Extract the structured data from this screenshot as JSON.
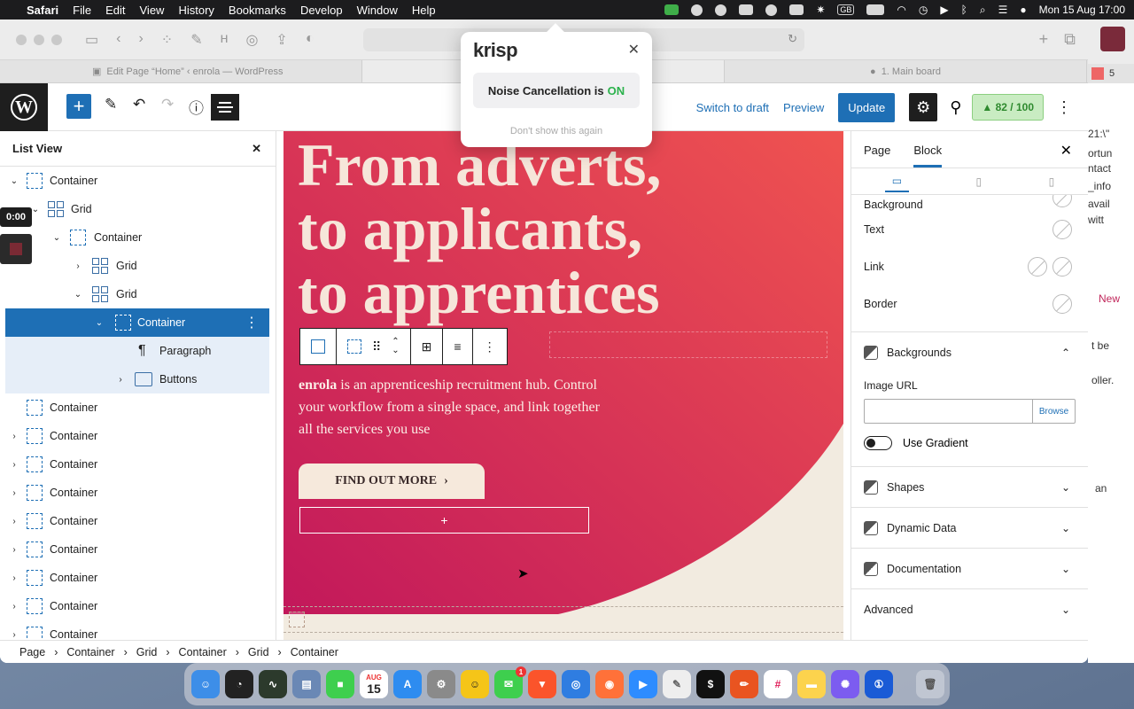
{
  "menubar": {
    "apple": "",
    "app": "Safari",
    "menus": [
      "File",
      "Edit",
      "View",
      "History",
      "Bookmarks",
      "Develop",
      "Window",
      "Help"
    ],
    "datetime": "Mon 15 Aug  17:00",
    "keyboard": "GB"
  },
  "browser": {
    "tabs": [
      {
        "label": "Edit Page “Home” ‹ enrola — WordPress"
      },
      {
        "label": ""
      },
      {
        "label": "1. Main board"
      }
    ]
  },
  "wp_toolbar": {
    "switch_draft": "Switch to draft",
    "preview": "Preview",
    "update": "Update",
    "score": "82 / 100"
  },
  "list_view": {
    "title": "List View",
    "items": [
      {
        "label": "Container",
        "type": "container"
      },
      {
        "label": "Grid",
        "type": "grid"
      },
      {
        "label": "Container",
        "type": "container"
      },
      {
        "label": "Grid",
        "type": "grid"
      },
      {
        "label": "Grid",
        "type": "grid"
      },
      {
        "label": "Container",
        "type": "container"
      },
      {
        "label": "Paragraph",
        "type": "paragraph"
      },
      {
        "label": "Buttons",
        "type": "buttons"
      },
      {
        "label": "Container",
        "type": "container"
      },
      {
        "label": "Container",
        "type": "container"
      },
      {
        "label": "Container",
        "type": "container"
      },
      {
        "label": "Container",
        "type": "container"
      },
      {
        "label": "Container",
        "type": "container"
      },
      {
        "label": "Container",
        "type": "container"
      },
      {
        "label": "Container",
        "type": "container"
      },
      {
        "label": "Container",
        "type": "container"
      },
      {
        "label": "Container",
        "type": "container"
      }
    ]
  },
  "recorder": {
    "time": "0:00"
  },
  "canvas": {
    "heading": [
      "From adverts,",
      "to applicants,",
      "to apprentices"
    ],
    "para_brand": "enrola",
    "para_rest": " is an apprenticeship recruitment hub. Control your workflow from a single space, and link together all the services you use",
    "cta": "FIND OUT MORE",
    "hero_colors": {
      "start": "#c2185b",
      "end": "#ef5350"
    }
  },
  "sidebar": {
    "tabs": [
      "Page",
      "Block"
    ],
    "rows": [
      "Background",
      "Text",
      "Link",
      "Border"
    ],
    "backgrounds": {
      "title": "Backgrounds",
      "image_url_label": "Image URL",
      "browse": "Browse",
      "gradient_label": "Use Gradient"
    },
    "sections": [
      "Shapes",
      "Dynamic Data",
      "Documentation",
      "Advanced"
    ]
  },
  "breadcrumbs": [
    "Page",
    "Container",
    "Grid",
    "Container",
    "Grid",
    "Container"
  ],
  "krisp": {
    "logo": "krisp",
    "message": "Noise Cancellation is",
    "state": "ON",
    "dismiss": "Don't show this again"
  },
  "right_peek": {
    "badge": "5",
    "lines": [
      "21:\\\"",
      "ortun",
      "ntact",
      "_info",
      "avail",
      "witt",
      "New",
      "t be",
      "oller.",
      "an"
    ]
  },
  "dock": {
    "calendar_month": "AUG",
    "calendar_day": "15",
    "messages_badge": "1"
  }
}
